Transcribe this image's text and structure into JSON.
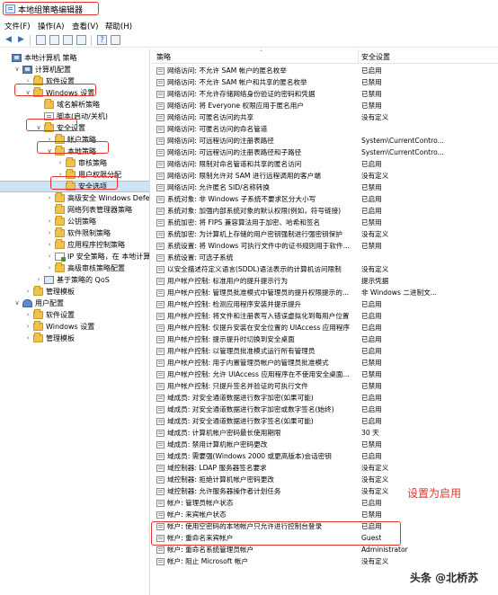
{
  "window": {
    "title": "本地组策略编辑器"
  },
  "menu": [
    "文件(F)",
    "操作(A)",
    "查看(V)",
    "帮助(H)"
  ],
  "toolbar": {
    "icons": [
      "back-icon",
      "forward-icon",
      "folder-icon",
      "console-tree-icon",
      "export-list-icon",
      "properties-icon",
      "help-icon",
      "filter-icon"
    ]
  },
  "tree": [
    {
      "label": "本地计算机 策略",
      "depth": 0,
      "icon": "computer-icon",
      "expander": ""
    },
    {
      "label": "计算机配置",
      "depth": 1,
      "icon": "computer-icon",
      "expander": "v"
    },
    {
      "label": "软件设置",
      "depth": 2,
      "icon": "folder-icon",
      "expander": ">"
    },
    {
      "label": "Windows 设置",
      "depth": 2,
      "icon": "folder-icon",
      "expander": "v"
    },
    {
      "label": "域名解析策略",
      "depth": 3,
      "icon": "folder-icon",
      "expander": ""
    },
    {
      "label": "脚本(启动/关机)",
      "depth": 3,
      "icon": "document-icon",
      "expander": ""
    },
    {
      "label": "安全设置",
      "depth": 3,
      "icon": "folder-icon",
      "expander": "v"
    },
    {
      "label": "帐户策略",
      "depth": 4,
      "icon": "folder-icon",
      "expander": ">"
    },
    {
      "label": "本地策略",
      "depth": 4,
      "icon": "folder-icon",
      "expander": "v"
    },
    {
      "label": "审核策略",
      "depth": 5,
      "icon": "folder-icon",
      "expander": ">"
    },
    {
      "label": "用户权限分配",
      "depth": 5,
      "icon": "folder-icon",
      "expander": ">"
    },
    {
      "label": "安全选项",
      "depth": 5,
      "icon": "folder-icon",
      "expander": "",
      "selected": true
    },
    {
      "label": "高级安全 Windows Defend",
      "depth": 4,
      "icon": "folder-icon",
      "expander": ">"
    },
    {
      "label": "网络列表管理器策略",
      "depth": 4,
      "icon": "folder-icon",
      "expander": ""
    },
    {
      "label": "公钥策略",
      "depth": 4,
      "icon": "folder-icon",
      "expander": ">"
    },
    {
      "label": "软件限制策略",
      "depth": 4,
      "icon": "folder-icon",
      "expander": ">"
    },
    {
      "label": "应用程序控制策略",
      "depth": 4,
      "icon": "folder-icon",
      "expander": ">"
    },
    {
      "label": "IP 安全策略，在 本地计算机",
      "depth": 4,
      "icon": "policy-icon",
      "expander": ">"
    },
    {
      "label": "高级审核策略配置",
      "depth": 4,
      "icon": "folder-icon",
      "expander": ">"
    },
    {
      "label": "基于策略的 QoS",
      "depth": 3,
      "icon": "monitor-icon",
      "expander": ">"
    },
    {
      "label": "管理模板",
      "depth": 2,
      "icon": "folder-icon",
      "expander": ">"
    },
    {
      "label": "用户配置",
      "depth": 1,
      "icon": "user-icon",
      "expander": "v"
    },
    {
      "label": "软件设置",
      "depth": 2,
      "icon": "folder-icon",
      "expander": ">"
    },
    {
      "label": "Windows 设置",
      "depth": 2,
      "icon": "folder-icon",
      "expander": ">"
    },
    {
      "label": "管理模板",
      "depth": 2,
      "icon": "folder-icon",
      "expander": ">"
    }
  ],
  "list": {
    "col_policy": "策略",
    "col_setting": "安全设置",
    "rows": [
      {
        "name": "网络访问: 不允许 SAM 帐户的匿名枚举",
        "setting": "已启用"
      },
      {
        "name": "网络访问: 不允许 SAM 帐户和共享的匿名枚举",
        "setting": "已禁用"
      },
      {
        "name": "网络访问: 不允许存储网络身份验证的密码和凭据",
        "setting": "已禁用"
      },
      {
        "name": "网络访问: 将 Everyone 权限应用于匿名用户",
        "setting": "已禁用"
      },
      {
        "name": "网络访问: 可匿名访问的共享",
        "setting": "没有定义"
      },
      {
        "name": "网络访问: 可匿名访问的命名管道",
        "setting": ""
      },
      {
        "name": "网络访问: 可远程访问的注册表路径",
        "setting": "System\\CurrentContro..."
      },
      {
        "name": "网络访问: 可远程访问的注册表路径和子路径",
        "setting": "System\\CurrentContro..."
      },
      {
        "name": "网络访问: 限制对命名管道和共享的匿名访问",
        "setting": "已启用"
      },
      {
        "name": "网络访问: 限制允许对 SAM 进行远程调用的客户端",
        "setting": "没有定义"
      },
      {
        "name": "网络访问: 允许匿名 SID/名称转换",
        "setting": "已禁用"
      },
      {
        "name": "系统对象: 非 Windows 子系统不要求区分大小写",
        "setting": "已启用"
      },
      {
        "name": "系统对象: 加强内部系统对象的默认权限(例如，符号链接)",
        "setting": "已启用"
      },
      {
        "name": "系统加密: 将 FIPS 兼容算法用于加密、哈希和签名",
        "setting": "已禁用"
      },
      {
        "name": "系统加密: 为计算机上存储的用户密钥强制进行强密钥保护",
        "setting": "没有定义"
      },
      {
        "name": "系统设置: 将 Windows 可执行文件中的证书规则用于软件...",
        "setting": "已禁用"
      },
      {
        "name": "系统设置: 可选子系统",
        "setting": ""
      },
      {
        "name": "以安全描述符定义语言(SDDL)语法表示的计算机访问限制",
        "setting": "没有定义"
      },
      {
        "name": "用户帐户控制: 标准用户的提升提示行为",
        "setting": "提示凭据"
      },
      {
        "name": "用户帐户控制: 管理员批准模式中管理员的提升权限提示的...",
        "setting": "非 Windows 二进制文..."
      },
      {
        "name": "用户帐户控制: 检测应用程序安装并提示提升",
        "setting": "已启用"
      },
      {
        "name": "用户帐户控制: 将文件和注册表写入错误虚拟化到每用户位置",
        "setting": "已启用"
      },
      {
        "name": "用户帐户控制: 仅提升安装在安全位置的 UIAccess 应用程序",
        "setting": "已启用"
      },
      {
        "name": "用户帐户控制: 提示提升时切换到安全桌面",
        "setting": "已启用"
      },
      {
        "name": "用户帐户控制: 以管理员批准模式运行所有管理员",
        "setting": "已启用"
      },
      {
        "name": "用户帐户控制: 用于内置管理员帐户的管理员批准模式",
        "setting": "已禁用"
      },
      {
        "name": "用户帐户控制: 允许 UIAccess 应用程序在不使用安全桌面...",
        "setting": "已禁用"
      },
      {
        "name": "用户帐户控制: 只提升签名并验证的可执行文件",
        "setting": "已禁用"
      },
      {
        "name": "域成员: 对安全通道数据进行数字加密(如果可能)",
        "setting": "已启用"
      },
      {
        "name": "域成员: 对安全通道数据进行数字加密或数字签名(始终)",
        "setting": "已启用"
      },
      {
        "name": "域成员: 对安全通道数据进行数字签名(如果可能)",
        "setting": "已启用"
      },
      {
        "name": "域成员: 计算机帐户密码最长使用期限",
        "setting": "30 天"
      },
      {
        "name": "域成员: 禁用计算机帐户密码更改",
        "setting": "已禁用"
      },
      {
        "name": "域成员: 需要强(Windows 2000 或更高版本)会话密钥",
        "setting": "已启用"
      },
      {
        "name": "域控制器: LDAP 服务器签名要求",
        "setting": "没有定义"
      },
      {
        "name": "域控制器: 拒绝计算机帐户密码更改",
        "setting": "没有定义"
      },
      {
        "name": "域控制器: 允许服务器操作者计划任务",
        "setting": "没有定义"
      },
      {
        "name": "帐户: 管理员帐户状态",
        "setting": "已启用"
      },
      {
        "name": "帐户: 来宾帐户状态",
        "setting": "已禁用"
      },
      {
        "name": "帐户: 使用空密码的本地帐户只允许进行控制台登录",
        "setting": "已启用"
      },
      {
        "name": "帐户: 重命名来宾帐户",
        "setting": "Guest"
      },
      {
        "name": "帐户: 重命名系统管理员帐户",
        "setting": "Administrator"
      },
      {
        "name": "帐户: 阻止 Microsoft 帐户",
        "setting": "没有定义"
      }
    ]
  },
  "annotation": "设置为启用",
  "watermark": "头条 @北桥苏",
  "colors": {
    "highlight": "#e0352b",
    "selection": "#cce4f7"
  }
}
